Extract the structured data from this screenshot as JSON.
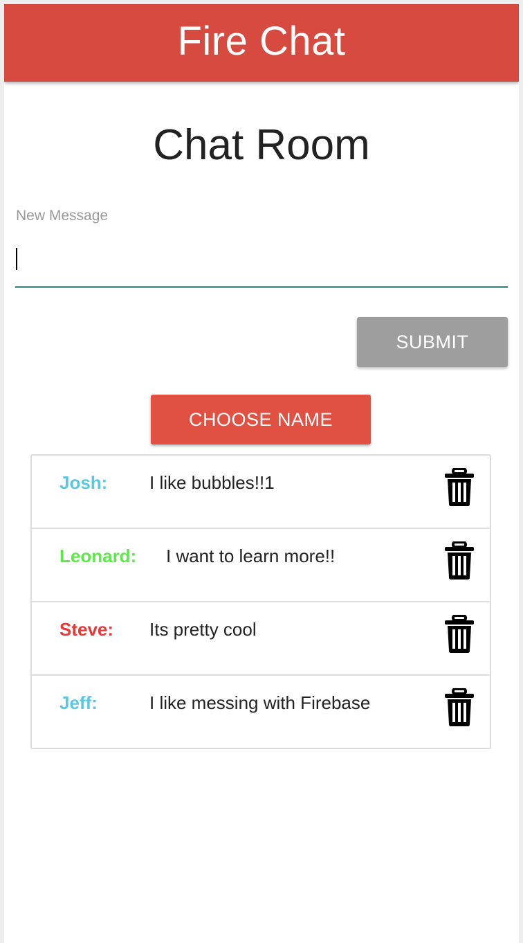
{
  "app": {
    "title": "Fire Chat"
  },
  "page": {
    "title": "Chat Room"
  },
  "new_message": {
    "label": "New Message",
    "value": "",
    "placeholder": ""
  },
  "buttons": {
    "submit": "SUBMIT",
    "choose_name": "CHOOSE NAME"
  },
  "messages": [
    {
      "author": "Josh:",
      "text": "I like bubbles!!1",
      "color": "#5bc8e0"
    },
    {
      "author": "Leonard:",
      "text": "I want to learn more!!",
      "color": "#5fe84a"
    },
    {
      "author": "Steve:",
      "text": "Its pretty cool",
      "color": "#e43a3a"
    },
    {
      "author": "Jeff:",
      "text": "I like messing with Firebase",
      "color": "#5bc8e0"
    }
  ],
  "icons": {
    "delete": "trash-icon"
  },
  "colors": {
    "appbar": "#d64a40",
    "choose_name_button": "#e05142",
    "submit_button": "#9e9e9e",
    "input_underline": "#4fa196"
  }
}
